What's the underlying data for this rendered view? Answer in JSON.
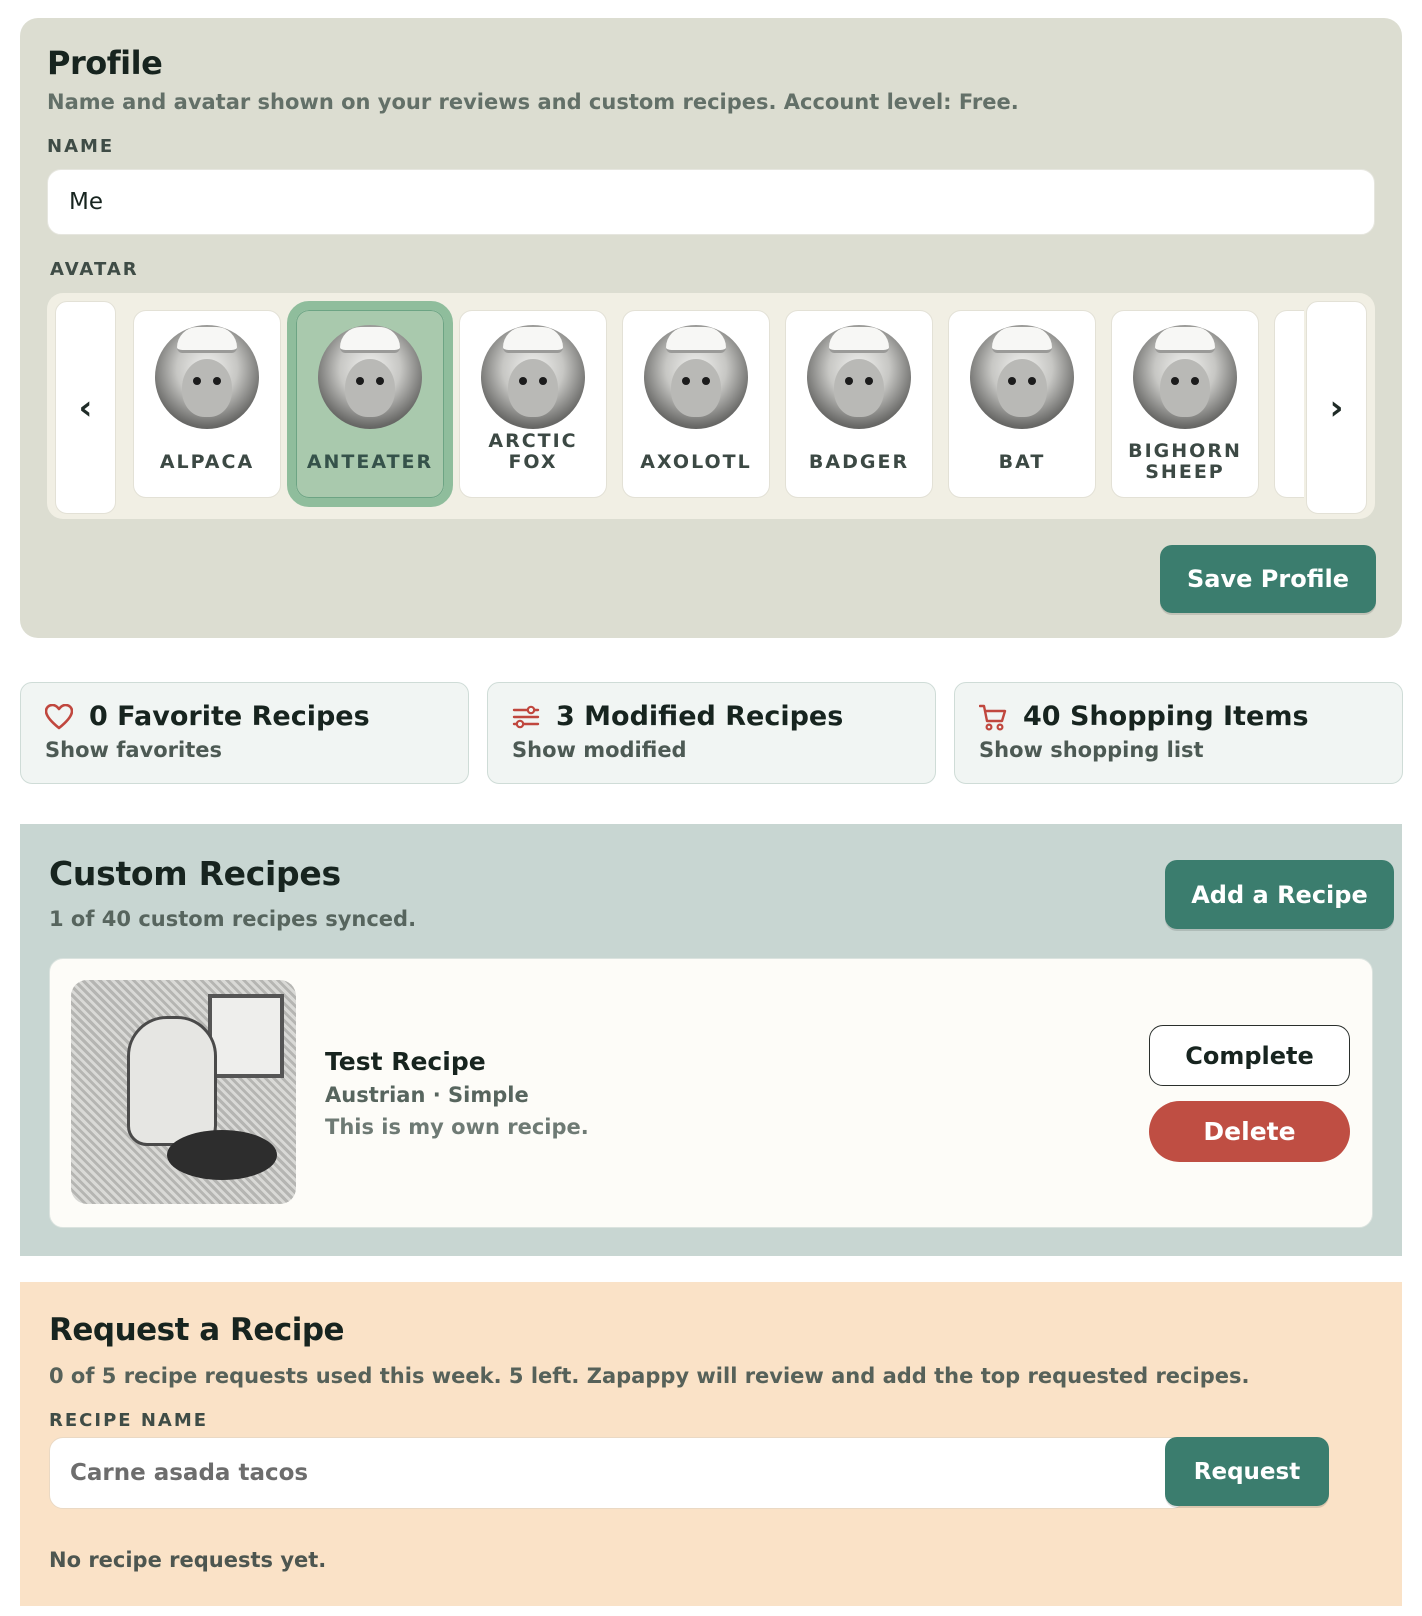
{
  "profile": {
    "title": "Profile",
    "subtitle": "Name and avatar shown on your reviews and custom recipes. Account level: Free.",
    "name_label": "NAME",
    "name_value": "Me",
    "avatar_label": "AVATAR",
    "prev_arrow": "‹",
    "next_arrow": "›",
    "avatars": [
      {
        "name": "ALPACA",
        "selected": false
      },
      {
        "name": "ANTEATER",
        "selected": true
      },
      {
        "name": "ARCTIC FOX",
        "selected": false
      },
      {
        "name": "AXOLOTL",
        "selected": false
      },
      {
        "name": "BADGER",
        "selected": false
      },
      {
        "name": "BAT",
        "selected": false
      },
      {
        "name_line1": "BIGHORN",
        "name_line2": "SHEEP",
        "selected": false
      }
    ],
    "save_label": "Save Profile"
  },
  "stats": [
    {
      "icon": "heart-icon",
      "title": "0 Favorite Recipes",
      "link": "Show favorites"
    },
    {
      "icon": "sliders-icon",
      "title": "3 Modified Recipes",
      "link": "Show modified"
    },
    {
      "icon": "cart-icon",
      "title": "40 Shopping Items",
      "link": "Show shopping list"
    }
  ],
  "custom": {
    "title": "Custom Recipes",
    "subtitle": "1 of 40 custom recipes synced.",
    "add_label": "Add a Recipe",
    "recipe": {
      "title": "Test Recipe",
      "meta": "Austrian · Simple",
      "description": "This is my own recipe.",
      "complete_label": "Complete",
      "delete_label": "Delete"
    }
  },
  "request": {
    "title": "Request a Recipe",
    "subtitle": "0 of 5 recipe requests used this week. 5 left. Zapappy will review and add the top requested recipes.",
    "field_label": "RECIPE NAME",
    "placeholder": "Carne asada tacos",
    "button_label": "Request",
    "empty_note": "No recipe requests yet."
  },
  "colors": {
    "accent": "#3b7d6e",
    "danger": "#bf4e43",
    "icon_red": "#c0473e"
  }
}
